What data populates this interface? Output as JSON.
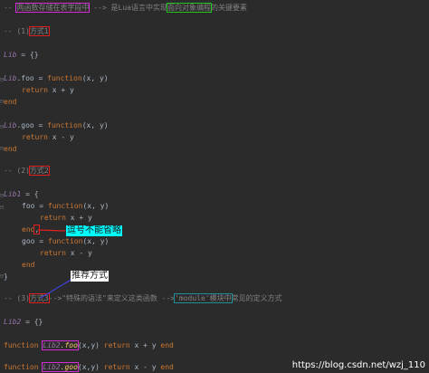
{
  "code": {
    "line1": {
      "dashes": "-- ",
      "note": "两函数存储在表字段中",
      "arrow": " --> 是Lua语言中实现",
      "note2": "面向对象编程",
      "tail": "的关键要素"
    },
    "sec1": {
      "prefix": "-- (1)",
      "label": "方式1"
    },
    "lib_decl": {
      "name": "Lib",
      "rest": " = {}"
    },
    "foo_sig": {
      "name": "Lib",
      "rest1": ".foo = ",
      "kw": "function",
      "rest2": "(x, y)"
    },
    "foo_body": {
      "kw": "return",
      "rest": " x + y"
    },
    "end1": "end",
    "goo_sig": {
      "name": "Lib",
      "rest1": ".goo = ",
      "kw": "function",
      "rest2": "(x, y)"
    },
    "goo_body": {
      "kw": "return",
      "rest": " x - y"
    },
    "end2": "end",
    "sec2": {
      "prefix": "-- (2)",
      "label": "方式2"
    },
    "lib1_decl": {
      "name": "Lib1",
      "rest": " = {"
    },
    "foo1_sig": {
      "rest1": "foo = ",
      "kw": "function",
      "rest2": "(x, y)"
    },
    "foo1_body": {
      "kw": "return",
      "rest": " x + y"
    },
    "end3": {
      "kw": "end",
      "rest": ","
    },
    "goo1_sig": {
      "rest1": "goo = ",
      "kw": "function",
      "rest2": "(x, y)"
    },
    "goo1_body": {
      "kw": "return",
      "rest": " x - y"
    },
    "end4": "end",
    "close": "}",
    "sec3": {
      "prefix": "-- (3)",
      "label": "方式3",
      "mid": "-->\"特殊的语法\"来定义这类函数 -->",
      "mod": "'module'模块中",
      "tail": "常见的定义方式"
    },
    "lib2_decl": {
      "name": "Lib2",
      "rest": " = {}"
    },
    "foo2_line": {
      "kw": "function",
      "name": "Lib2",
      "fname": ".foo",
      "rest": "(x,y) ",
      "kw2": "return",
      "rest2": " x + y ",
      "kw3": "end"
    },
    "goo2_line": {
      "kw": "function",
      "name": "Lib2",
      "fname": ".goo",
      "rest": "(x,y) ",
      "kw2": "return",
      "rest2": " x - y ",
      "kw3": "end"
    }
  },
  "annotations": {
    "comma_note": "逗号不能省略",
    "recommend": "推荐方式"
  },
  "watermark": "https://blog.csdn.net/wzj_110",
  "colors": {
    "background": "#2b2b2b",
    "keyword": "#cc7832",
    "identifier": "#9876aa",
    "comment": "#808080",
    "magenta_box": "#d62bd6",
    "red_box": "#e02020",
    "green_box": "#21c421"
  }
}
